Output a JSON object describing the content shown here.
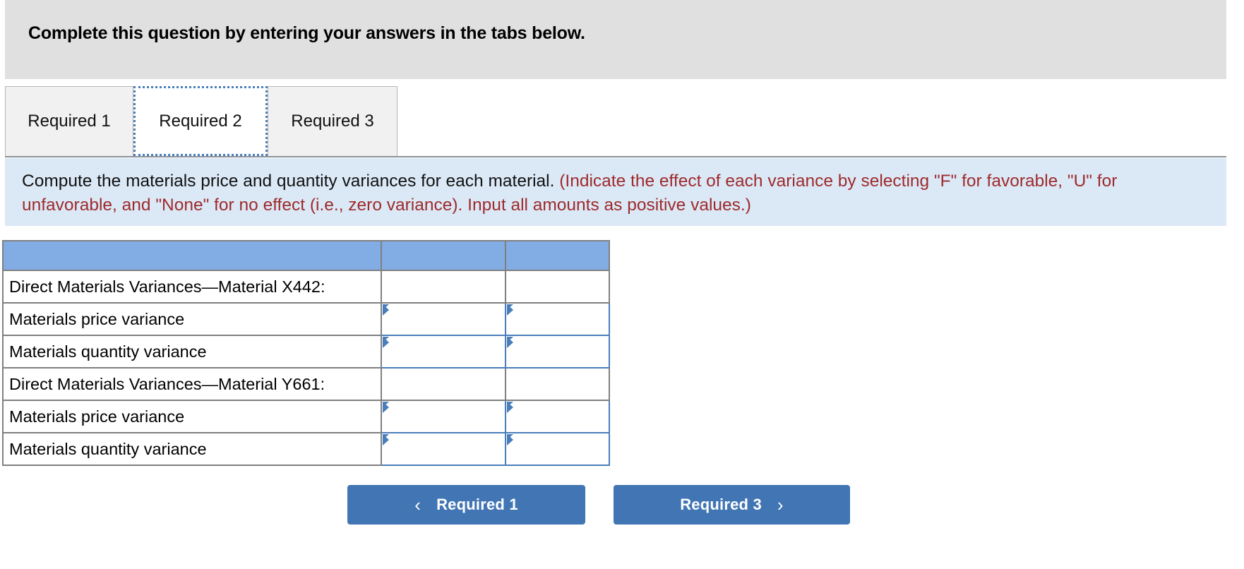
{
  "banner": {
    "text": "Complete this question by entering your answers in the tabs below."
  },
  "tabs": {
    "items": [
      {
        "label": "Required 1",
        "active": false
      },
      {
        "label": "Required 2",
        "active": true
      },
      {
        "label": "Required 3",
        "active": false
      }
    ]
  },
  "instructions": {
    "main": "Compute the materials price and quantity variances for each material. ",
    "note": "(Indicate the effect of each variance by selecting \"F\" for favorable, \"U\" for unfavorable, and \"None\" for no effect (i.e., zero variance). Input all amounts as positive values.)"
  },
  "table": {
    "header": {
      "label": "",
      "amount": "",
      "effect": ""
    },
    "rows": [
      {
        "label": "Direct Materials Variances—Material X442:",
        "amount": "",
        "effect": "",
        "input": false
      },
      {
        "label": "Materials price variance",
        "amount": "",
        "effect": "",
        "input": true
      },
      {
        "label": "Materials quantity variance",
        "amount": "",
        "effect": "",
        "input": true
      },
      {
        "label": "Direct Materials Variances—Material Y661:",
        "amount": "",
        "effect": "",
        "input": false
      },
      {
        "label": "Materials price variance",
        "amount": "",
        "effect": "",
        "input": true
      },
      {
        "label": "Materials quantity variance",
        "amount": "",
        "effect": "",
        "input": true
      }
    ]
  },
  "nav": {
    "prev_label": "Required 1",
    "prev_chevron": "‹",
    "next_label": "Required 3",
    "next_chevron": "›"
  },
  "colors": {
    "banner_bg": "#e0e0e0",
    "instruction_bg": "#dbe9f7",
    "note_text": "#9e2a2b",
    "table_header_bg": "#82ace4",
    "input_border": "#4a7ebb",
    "button_bg": "#4175b4",
    "tab_inactive_bg": "#f1f1f1",
    "tab_active_bg": "#ffffff"
  }
}
